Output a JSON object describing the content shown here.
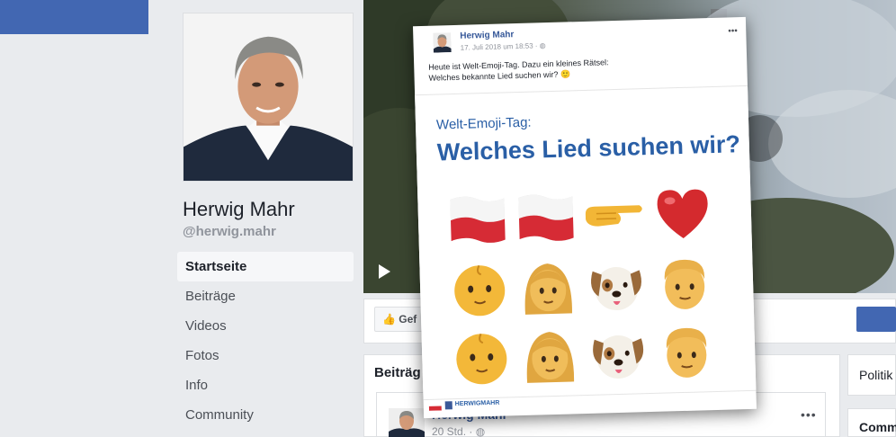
{
  "profile": {
    "name": "Herwig Mahr",
    "handle": "@herwig.mahr"
  },
  "nav": {
    "items": [
      "Startseite",
      "Beiträge",
      "Videos",
      "Fotos",
      "Info",
      "Community"
    ],
    "active_index": 0
  },
  "actions": {
    "like_label": "Gef"
  },
  "posts": {
    "title": "Beiträg",
    "author": "Herwig Mahr",
    "time": "20 Std. · ",
    "menu": "•••"
  },
  "sidebar": {
    "card1": "Politik",
    "card2": "Comm"
  },
  "overlay_post": {
    "author": "Herwig Mahr",
    "time": "17. Juli 2018 um 18:53 · ",
    "menu": "•••",
    "text_line1": "Heute ist Welt-Emoji-Tag. Dazu ein kleines Rätsel:",
    "text_line2": "Welches bekannte Lied suchen wir? 🙂",
    "image_subtitle": "Welt-Emoji-Tag:",
    "image_headline": "Welches Lied suchen wir?",
    "brand": "HERWIGMAHR",
    "emoji_grid": [
      [
        "flag-icon",
        "flag-icon",
        "pointing-hand-icon",
        "heart-icon"
      ],
      [
        "baby-icon",
        "woman-icon",
        "dog-icon",
        "man-icon"
      ],
      [
        "baby-icon",
        "woman-icon",
        "dog-icon",
        "man-icon"
      ]
    ]
  },
  "colors": {
    "brand_blue": "#4267b2",
    "headline_blue": "#2a5fa6",
    "link_blue": "#365899"
  }
}
